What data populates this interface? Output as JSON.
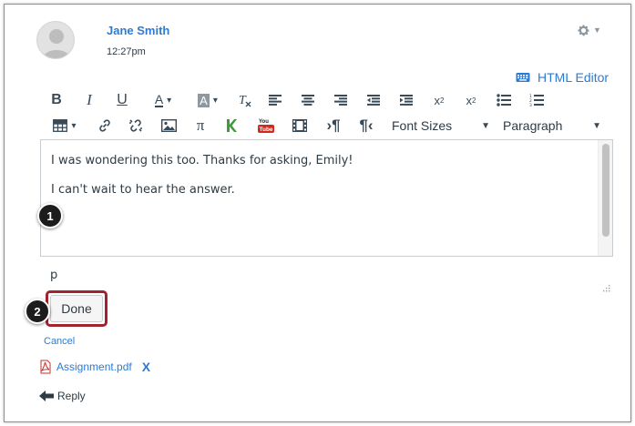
{
  "post": {
    "author": "Jane Smith",
    "time": "12:27pm"
  },
  "icons": {
    "settings": "gear-icon",
    "html_editor": "keyboard-icon",
    "attachment": "pdf-icon",
    "reply": "reply-arrow-icon"
  },
  "editor": {
    "html_editor_label": "HTML Editor",
    "font_sizes_label": "Font Sizes",
    "paragraph_label": "Paragraph",
    "toolbar_row1": [
      "bold",
      "italic",
      "underline",
      "text-color",
      "background-color",
      "clear-formatting",
      "align-left",
      "align-center",
      "align-right",
      "outdent",
      "indent",
      "superscript",
      "subscript",
      "bullet-list",
      "numbered-list"
    ],
    "toolbar_row2": [
      "table",
      "link",
      "unlink",
      "image",
      "math-equation",
      "kaltura-media",
      "youtube-media",
      "record-media",
      "ltr",
      "rtl"
    ],
    "content_lines": [
      "I was wondering this too. Thanks for asking, Emily!",
      "I can't wait to hear the answer."
    ],
    "path": "p"
  },
  "callouts": [
    "1",
    "2"
  ],
  "actions": {
    "done_label": "Done",
    "cancel_label": "Cancel",
    "reply_label": "Reply"
  },
  "attachment": {
    "filename": "Assignment.pdf",
    "remove_label": "X"
  },
  "colors": {
    "link": "#2d7bd1",
    "text": "#2d3b45",
    "highlight": "#a1232e",
    "youtube_red": "#d12a1d",
    "kaltura_green": "#3f9a3a"
  }
}
